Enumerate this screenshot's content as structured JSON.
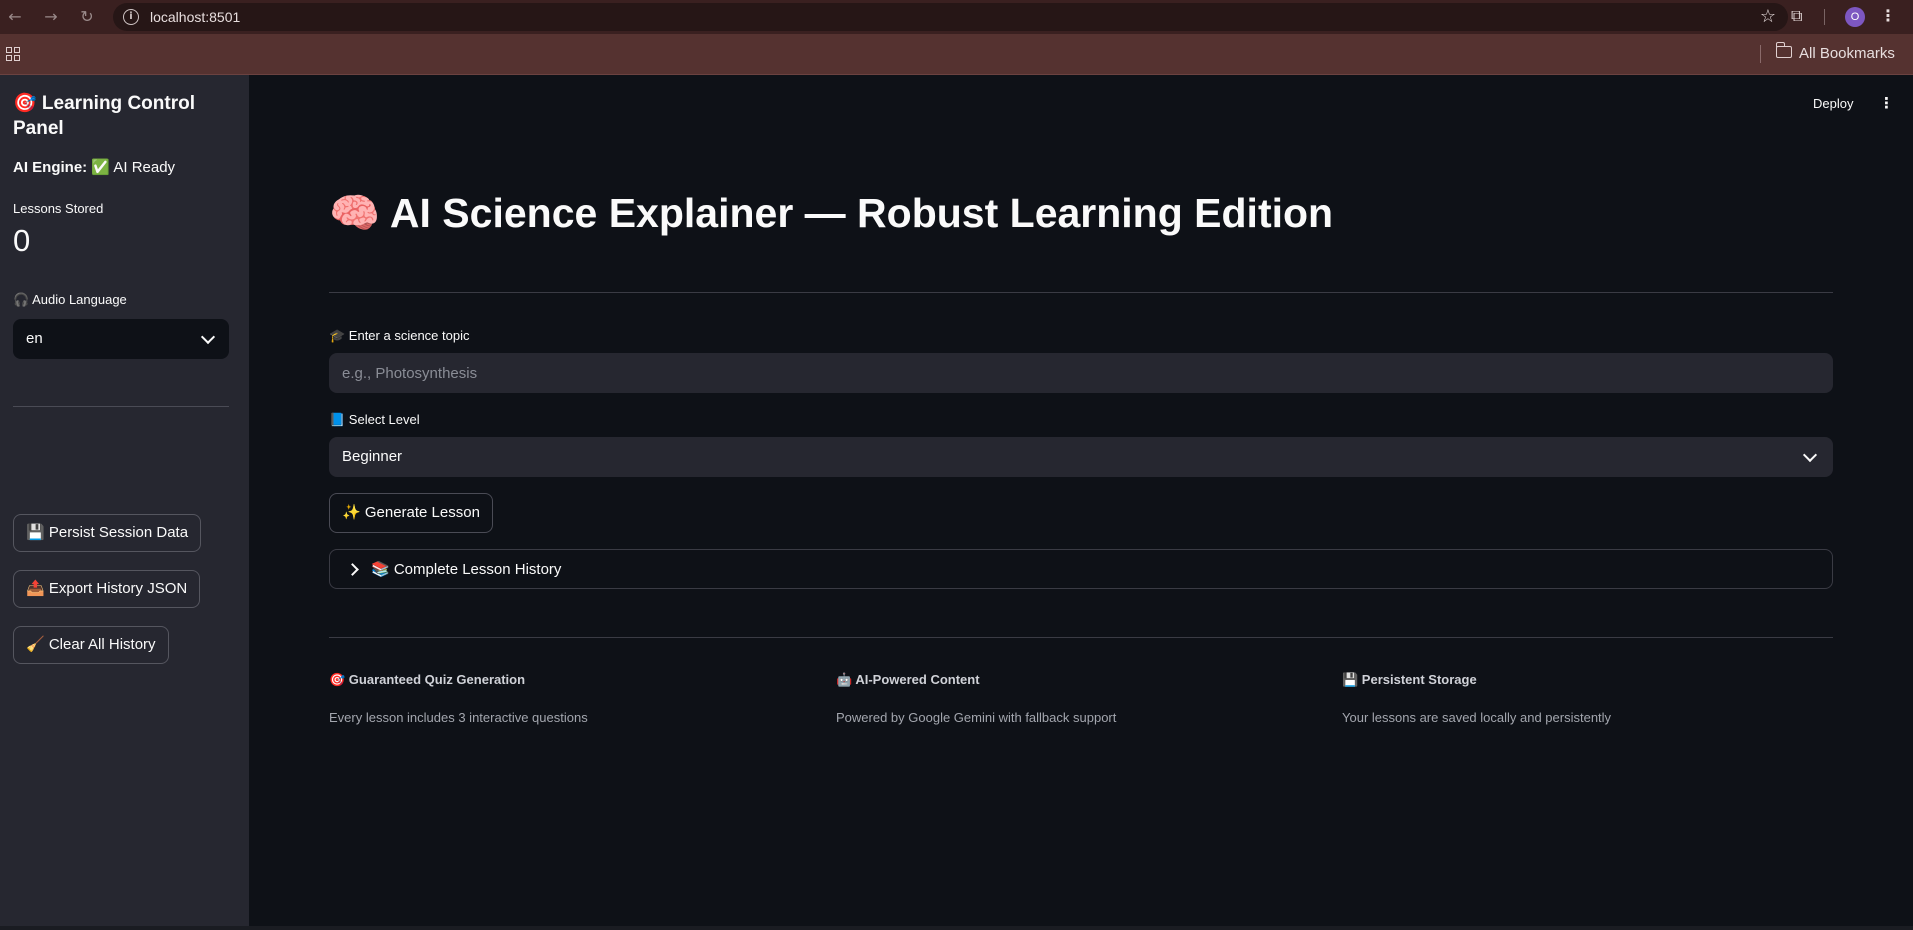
{
  "browser": {
    "url": "localhost:8501",
    "avatar_letter": "O",
    "bookmarks_label": "All Bookmarks",
    "icons": [
      "back-icon",
      "forward-icon",
      "reload-icon",
      "info-icon",
      "star-icon",
      "extensions-icon",
      "menu-icon",
      "apps-icon",
      "folder-icon"
    ]
  },
  "sidebar": {
    "title": "🎯 Learning Control Panel",
    "engine_label": "AI Engine:",
    "engine_status": "✅ AI Ready",
    "lessons_label": "Lessons Stored",
    "lessons_value": "0",
    "audio_label": "🎧 Audio Language",
    "audio_value": "en",
    "buttons": {
      "persist": "💾 Persist Session Data",
      "export": "📤 Export History JSON",
      "clear": "🧹 Clear All History"
    }
  },
  "header": {
    "deploy": "Deploy"
  },
  "main": {
    "title": "🧠 AI Science Explainer — Robust Learning Edition",
    "topic_label": "🎓 Enter a science topic",
    "topic_placeholder": "e.g., Photosynthesis",
    "topic_value": "",
    "level_label": "📘 Select Level",
    "level_value": "Beginner",
    "generate_button": "✨ Generate Lesson",
    "history_expander": "📚 Complete Lesson History"
  },
  "features": [
    {
      "title": "🎯 Guaranteed Quiz Generation",
      "desc": "Every lesson includes 3 interactive questions"
    },
    {
      "title": "🤖 AI-Powered Content",
      "desc": "Powered by Google Gemini with fallback support"
    },
    {
      "title": "💾 Persistent Storage",
      "desc": "Your lessons are saved locally and persistently"
    }
  ],
  "colors": {
    "background": "#0e1117",
    "sidebar": "#262730",
    "text": "#fafafa",
    "chrome": "#3a2020"
  }
}
